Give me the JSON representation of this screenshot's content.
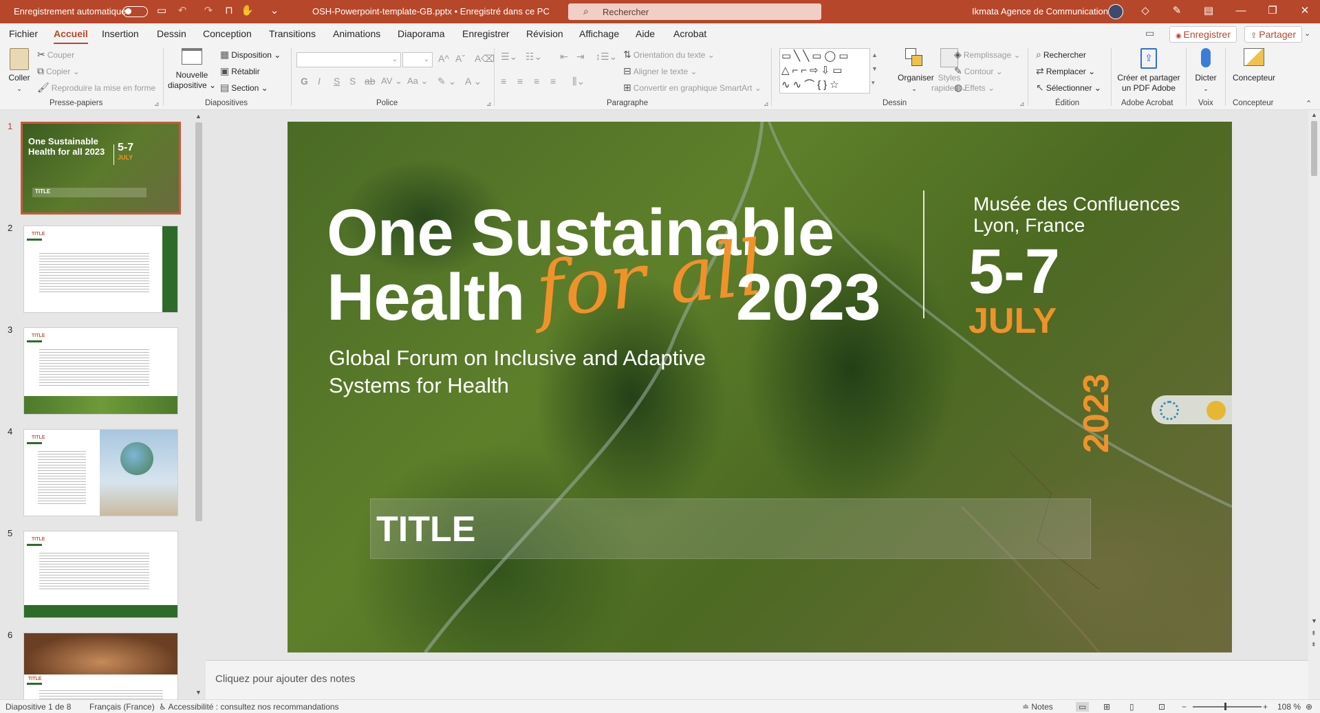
{
  "titlebar": {
    "autosave_label": "Enregistrement automatique",
    "filename": "OSH-Powerpoint-template-GB.pptx • Enregistré dans ce PC",
    "search_placeholder": "Rechercher",
    "account": "Ikmata Agence de Communication"
  },
  "menu": {
    "tabs": [
      "Fichier",
      "Accueil",
      "Insertion",
      "Dessin",
      "Conception",
      "Transitions",
      "Animations",
      "Diaporama",
      "Enregistrer",
      "Révision",
      "Affichage",
      "Aide",
      "Acrobat"
    ],
    "active_tab": "Accueil",
    "save_button": "Enregistrer",
    "share_button": "Partager"
  },
  "ribbon": {
    "clipboard": {
      "paste": "Coller",
      "cut": "Couper",
      "copy": "Copier",
      "format_painter": "Reproduire la mise en forme",
      "label": "Presse-papiers"
    },
    "slides": {
      "new_slide_line1": "Nouvelle",
      "new_slide_line2": "diapositive",
      "layout": "Disposition",
      "reset": "Rétablir",
      "section": "Section",
      "label": "Diapositives"
    },
    "font": {
      "label": "Police"
    },
    "paragraph": {
      "text_direction": "Orientation du texte",
      "align_text": "Aligner le texte",
      "smartart": "Convertir en graphique SmartArt",
      "label": "Paragraphe"
    },
    "drawing": {
      "arrange": "Organiser",
      "styles_line1": "Styles",
      "styles_line2": "rapides",
      "fill": "Remplissage",
      "outline": "Contour",
      "effects": "Effets",
      "label": "Dessin"
    },
    "editing": {
      "find": "Rechercher",
      "replace": "Remplacer",
      "select": "Sélectionner",
      "label": "Édition"
    },
    "acrobat": {
      "line1": "Créer et partager",
      "line2": "un PDF Adobe",
      "label": "Adobe Acrobat"
    },
    "voice": {
      "dictate": "Dicter",
      "label": "Voix"
    },
    "designer": {
      "button": "Concepteur",
      "label": "Concepteur"
    }
  },
  "thumbnails": {
    "numbers": [
      "1",
      "2",
      "3",
      "4",
      "5",
      "6"
    ],
    "thumb1_title": "One Sustainable Health for all 2023",
    "thumb1_dates": "5-7",
    "thumb1_month": "JULY",
    "thumb_title": "TITLE"
  },
  "slide": {
    "title_line1": "One Sustainable",
    "title_line2a": "Health",
    "title_script": "for all",
    "title_year": "2023",
    "subtitle_line1": "Global Forum on Inclusive and Adaptive",
    "subtitle_line2": "Systems for Health",
    "venue_line1": "Musée des Confluences",
    "venue_line2": "Lyon, France",
    "dates": "5-7",
    "month": "JULY",
    "year_vertical": "2023",
    "title_placeholder": "TITLE"
  },
  "notes_placeholder": "Cliquez pour ajouter des notes",
  "status": {
    "slide_count": "Diapositive 1 de 8",
    "language": "Français (France)",
    "accessibility": "Accessibilité : consultez nos recommandations",
    "notes": "Notes",
    "zoom": "108 %"
  },
  "colors": {
    "accent": "#b7472a",
    "orange": "#f0922b",
    "green": "#2e6b2b"
  }
}
